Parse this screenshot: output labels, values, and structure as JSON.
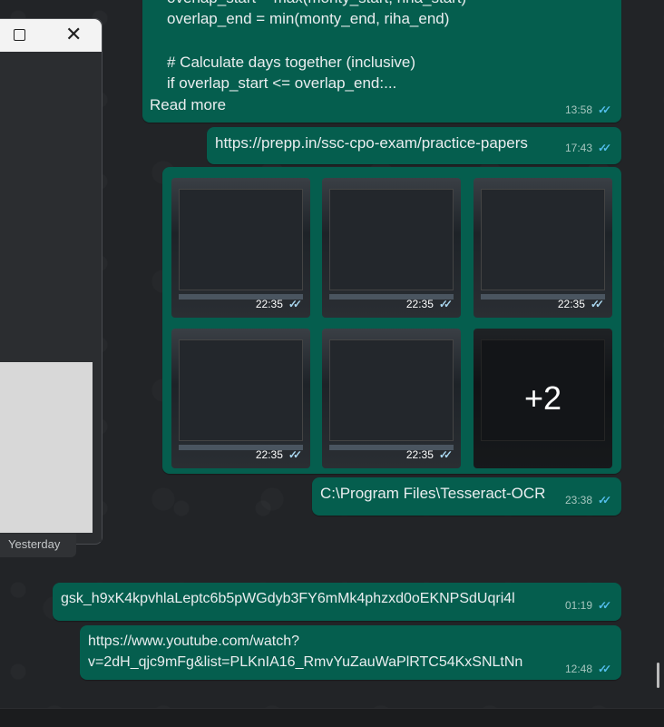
{
  "window": {
    "maximize_icon": "maximize-icon",
    "close_icon": "close-icon",
    "close_glyph": "✕"
  },
  "date_label": "Yesterday",
  "messages": {
    "code": {
      "line1": "overlap_start = max(monty_start, riha_start)",
      "line2": "overlap_end = min(monty_end, riha_end)",
      "line3": "# Calculate days together (inclusive)",
      "line4": "if overlap_start <= overlap_end:...",
      "read_more": "Read more",
      "time": "13:58"
    },
    "link1": {
      "text": "https://prepp.in/ssc-cpo-exam/practice-papers",
      "time": "17:43"
    },
    "media": {
      "thumbs": [
        {
          "time": "22:35"
        },
        {
          "time": "22:35"
        },
        {
          "time": "22:35"
        },
        {
          "time": "22:35"
        },
        {
          "time": "22:35"
        }
      ],
      "more": "+2"
    },
    "path": {
      "text": "C:\\Program Files\\Tesseract-OCR",
      "time": "23:38"
    },
    "key": {
      "text": "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",
      "time": "01:19"
    },
    "youtube": {
      "line1": "https://www.youtube.com/watch?",
      "line2": "v=2dH_qjc9mFg&list=PLKnIA16_RmvYuZauWaPlRTC54KxSNLtNn",
      "time": "12:48"
    }
  },
  "tick_glyph": "✓✓",
  "colors": {
    "bubble": "#055e4e",
    "link": "#53bdeb",
    "background": "#222427"
  }
}
